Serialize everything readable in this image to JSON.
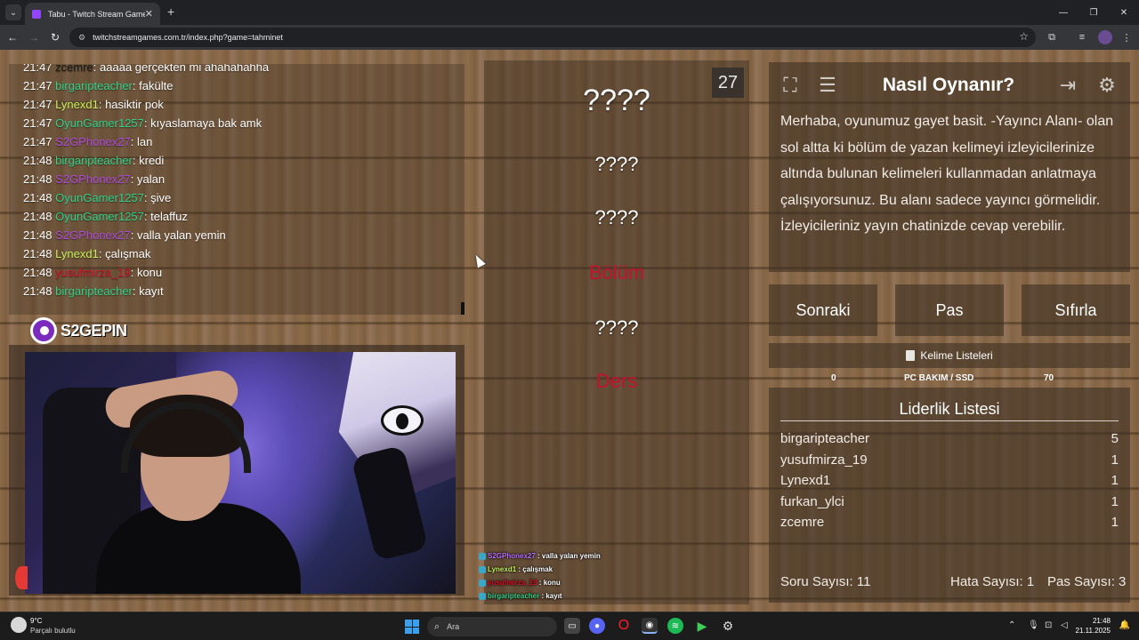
{
  "browser": {
    "tab_title": "Tabu - Twitch Stream Games",
    "url": "twitchstreamgames.com.tr/index.php?game=tahminet",
    "new_tab": "+",
    "tab_close": "✕"
  },
  "chat": {
    "lines": [
      {
        "time": "21:47",
        "user": "zcemre",
        "color": "#1a1a1a",
        "msg": "aaaaa gerçekten mi ahahahahha"
      },
      {
        "time": "21:47",
        "user": "birgaripteacher",
        "color": "#2fd38a",
        "msg": "fakülte"
      },
      {
        "time": "21:47",
        "user": "Lynexd1",
        "color": "#c9f25a",
        "msg": "hasiktir pok"
      },
      {
        "time": "21:47",
        "user": "OyunGamer1257",
        "color": "#2fd38a",
        "msg": "kıyaslamaya bak amk"
      },
      {
        "time": "21:47",
        "user": "S2GPhonex27",
        "color": "#b14bde",
        "msg": "lan"
      },
      {
        "time": "21:48",
        "user": "birgaripteacher",
        "color": "#2fd38a",
        "msg": "kredi"
      },
      {
        "time": "21:48",
        "user": "S2GPhonex27",
        "color": "#b14bde",
        "msg": "yalan"
      },
      {
        "time": "21:48",
        "user": "OyunGamer1257",
        "color": "#2fd38a",
        "msg": "şive"
      },
      {
        "time": "21:48",
        "user": "OyunGamer1257",
        "color": "#2fd38a",
        "msg": "telaffuz"
      },
      {
        "time": "21:48",
        "user": "S2GPhonex27",
        "color": "#b14bde",
        "msg": "valla yalan yemin"
      },
      {
        "time": "21:48",
        "user": "Lynexd1",
        "color": "#c9f25a",
        "msg": "çalışmak"
      },
      {
        "time": "21:48",
        "user": "yusufmirza_19",
        "color": "#d3112a",
        "msg": "konu"
      },
      {
        "time": "21:48",
        "user": "birgaripteacher",
        "color": "#2fd38a",
        "msg": "kayıt"
      }
    ]
  },
  "stream": {
    "logo_text": "S2GEPIN"
  },
  "card": {
    "timer": "27",
    "main_word": "????",
    "taboo_words": [
      "????",
      "????",
      "Bölüm",
      "????",
      "Ders"
    ],
    "taboo_colors": [
      "#ffffff",
      "#ffffff",
      "#c8102e",
      "#ffffff",
      "#c8102e"
    ]
  },
  "mini_chat": [
    {
      "user": "S2GPhonex27",
      "color": "#b870ff",
      "msg": "valla yalan yemin"
    },
    {
      "user": "Lynexd1",
      "color": "#c9f25a",
      "msg": "çalışmak"
    },
    {
      "user": "yusufmirza_19",
      "color": "#e0102a",
      "msg": "konu"
    },
    {
      "user": "birgaripteacher",
      "color": "#36d08a",
      "msg": "kayıt"
    }
  ],
  "how_to": {
    "title": "Nasıl Oynanır?",
    "text": "Merhaba, oyunumuz gayet basit. -Yayıncı Alanı- olan sol altta ki bölüm de yazan kelimeyi izleyicilerinize altında bulunan kelimeleri kullanmadan anlatmaya çalışıyorsunuz. Bu alanı sadece yayıncı görmelidir. İzleyicileriniz yayın chatinizde cevap verebilir."
  },
  "actions": {
    "next": "Sonraki",
    "pass": "Pas",
    "reset": "Sıfırla"
  },
  "word_lists": {
    "label": "Kelime Listeleri",
    "current_left": "0",
    "current_name": "PC BAKIM / SSD",
    "current_right": "70"
  },
  "leaderboard": {
    "title": "Liderlik Listesi",
    "rows": [
      {
        "name": "birgaripteacher",
        "score": "5"
      },
      {
        "name": "yusufmirza_19",
        "score": "1"
      },
      {
        "name": "Lynexd1",
        "score": "1"
      },
      {
        "name": "furkan_ylci",
        "score": "1"
      },
      {
        "name": "zcemre",
        "score": "1"
      }
    ]
  },
  "stats": {
    "questions": "Soru Sayısı: 11",
    "errors": "Hata Sayısı: 1",
    "passes": "Pas Sayısı: 3"
  },
  "taskbar": {
    "temp": "9°C",
    "weather": "Parçalı bulutlu",
    "search_placeholder": "Ara",
    "time": "21:48",
    "date": "21.11.2025"
  }
}
